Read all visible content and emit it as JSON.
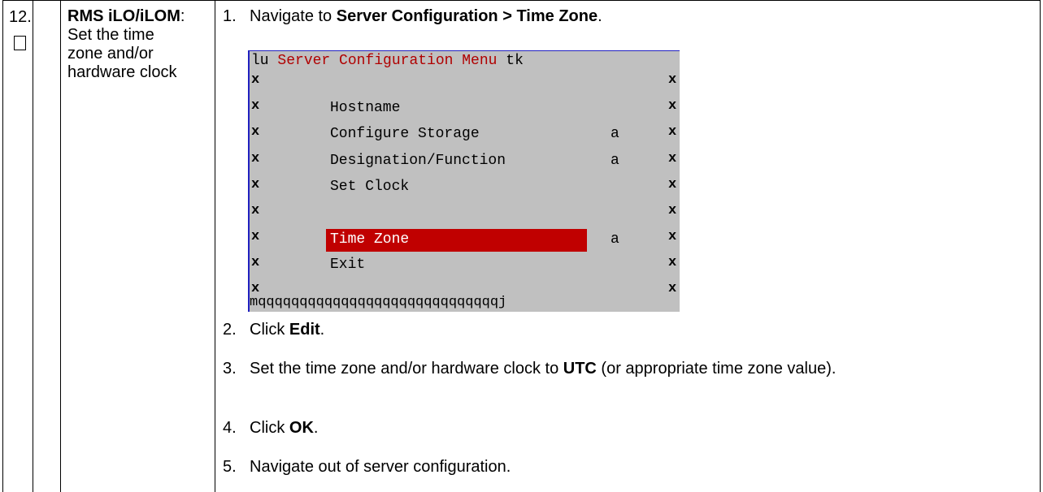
{
  "step": {
    "number": "12.",
    "title_bold": "RMS iLO/iLOM",
    "title_colon": ":",
    "description": "Set the time zone and/or hardware clock"
  },
  "instructions": {
    "s1": {
      "num": "1.",
      "pre": "Navigate to ",
      "bold": "Server Configuration > Time Zone",
      "post": "."
    },
    "s2": {
      "num": "2.",
      "pre": "Click ",
      "bold": "Edit",
      "post": "."
    },
    "s3": {
      "num": "3.",
      "pre": "Set the time zone and/or hardware clock to ",
      "bold": "UTC",
      "post": " (or appropriate time zone value)."
    },
    "s4": {
      "num": "4.",
      "pre": "Click ",
      "bold": "OK",
      "post": "."
    },
    "s5": {
      "num": "5.",
      "text": "Navigate out of server configuration."
    }
  },
  "terminal": {
    "title_left": "lu",
    "title_center": " Server Configuration Menu ",
    "title_right": "tk",
    "border_char": "x",
    "items": [
      {
        "label": "Hostname",
        "marker": ""
      },
      {
        "label": "Configure Storage",
        "marker": "a"
      },
      {
        "label": "Designation/Function",
        "marker": "a"
      },
      {
        "label": "Set Clock",
        "marker": ""
      },
      {
        "label": "Time Zone",
        "marker": "a"
      },
      {
        "label": "Exit",
        "marker": ""
      }
    ],
    "bottom_border": "mqqqqqqqqqqqqqqqqqqqqqqqqqqqqqj",
    "selected_item": "Time Zone",
    "colors": {
      "background": "#c0c0c0",
      "highlight": "#c00000",
      "title": "#b00000",
      "frame": "#2020c0"
    }
  }
}
